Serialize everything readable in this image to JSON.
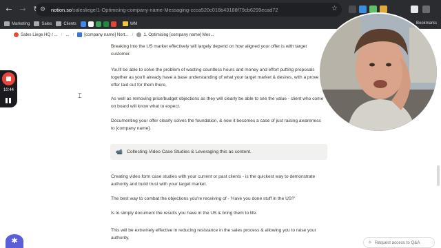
{
  "browser": {
    "url_host": "notion.so",
    "url_path": "/salesliege/1-Optimising-company-name-Messaging-ccca520c016b43188f79cb6299ecad72",
    "bookmarks": [
      "Marketing",
      "Sales",
      "Clients",
      "WM"
    ],
    "bookmarks_right": "Bookmarks"
  },
  "breadcrumbs": [
    "Sales Liege HQ / ...",
    "...",
    "[company name] Nort...",
    "1. Optimising [company name] Mes..."
  ],
  "content": {
    "p1": "Breaking into the US market effectively will largely depend on how aligned your offer is with target customer.",
    "p2": "You'll be able to solve the problem of wasting countless hours and money and effort putting proposals together as you'll already have a base understanding of what your target market & desires, with a proven offer laid out for them there,",
    "p3": "As well as removing price/budget objections as they will clearly be able to see the value - client who come on board will know what to expect.",
    "p4": "Documenting your offer clearly solves the foundation, & now it becomes a case of just raising awareness to [company name].",
    "callout": "Collecting Video Case Studies & Leveraging this as content.",
    "p5": "Creating video form case studies with your current or past clients - is the quickest way to demonstrate authority and build trust with your target market.",
    "p6": "The best way to combat the objections you're receiving of - 'Have you done stuff in the US?'",
    "p7": "Is to simply document the results you have in the US & bring them to life.",
    "p8": "This will be extremely effective in reducing resistance in the sales process & allowing you to raise your authority."
  },
  "recorder": {
    "time": "10:44"
  },
  "qa_button": "Request access to Q&A",
  "colors": {
    "record": "#e8463c",
    "badge": "#5b5ed9",
    "chrome": "#2b2c2f"
  }
}
